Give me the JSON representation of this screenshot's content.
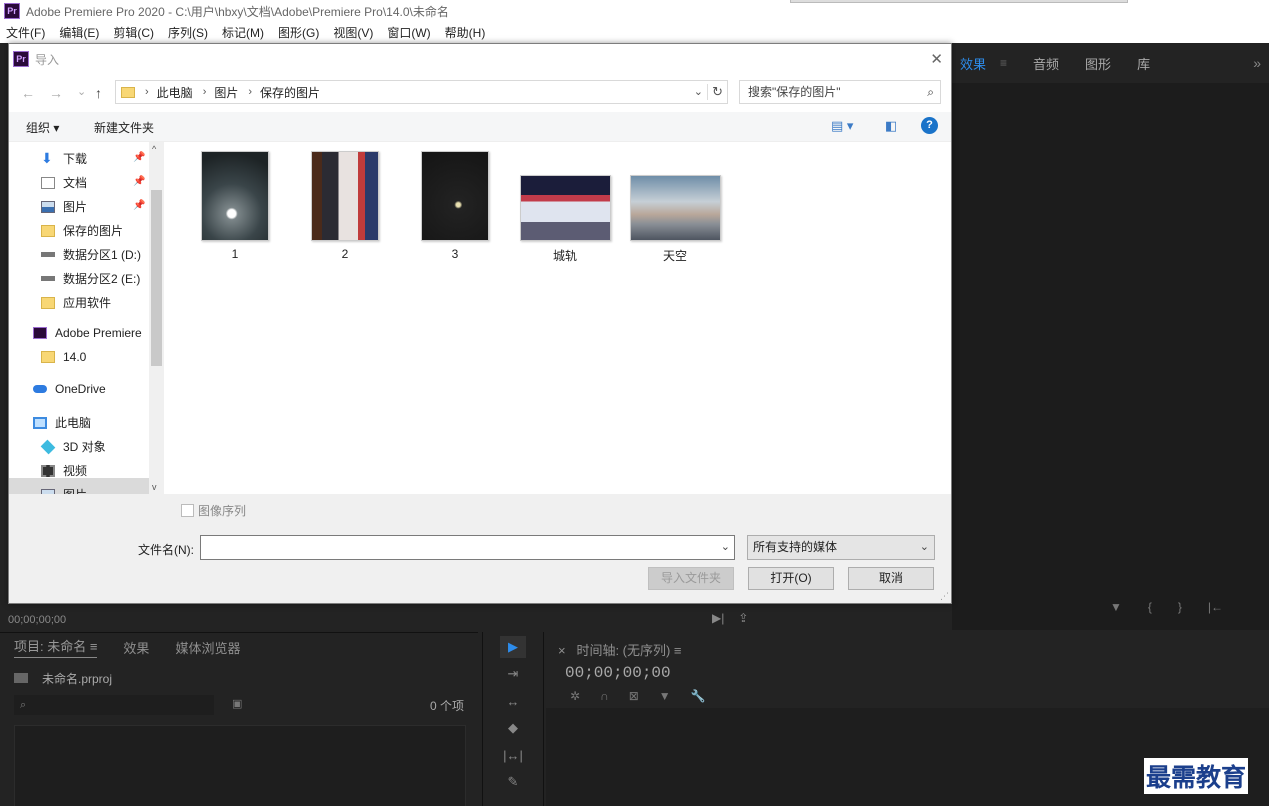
{
  "app": {
    "logo": "Pr",
    "title": "Adobe Premiere Pro 2020 - C:\\用户\\hbxy\\文档\\Adobe\\Premiere Pro\\14.0\\未命名",
    "menu": [
      "文件(F)",
      "编辑(E)",
      "剪辑(C)",
      "序列(S)",
      "标记(M)",
      "图形(G)",
      "视图(V)",
      "窗口(W)",
      "帮助(H)"
    ]
  },
  "right_tabs": {
    "active": "效果",
    "sep": "≡",
    "tabs": [
      "音频",
      "图形",
      "库"
    ],
    "more": "»"
  },
  "right_controls": [
    "▼",
    "{",
    "}",
    "|←"
  ],
  "source": {
    "timecode": "00;00;00;00",
    "icons": [
      "▶|",
      "⇪"
    ]
  },
  "project": {
    "tabs": [
      "项目: 未命名 ≡",
      "效果",
      "媒体浏览器"
    ],
    "file": "未命名.prproj",
    "search_icon": "⌕",
    "cam_icon": "▣",
    "count": "0 个项"
  },
  "tools": [
    "▶",
    "⇥",
    "↔",
    "◆",
    "|↔|",
    "✎"
  ],
  "timeline": {
    "tab": "时间轴: (无序列) ≡",
    "close": "×",
    "time": "00;00;00;00",
    "icons": [
      "✲",
      "∩",
      "⊠",
      "▼",
      "🔧"
    ]
  },
  "watermark": "最需教育",
  "dialog": {
    "title": "导入",
    "close": "✕",
    "nav": {
      "back": "←",
      "forward": "→",
      "recent": "⌄",
      "up": "↑"
    },
    "breadcrumbs": [
      "此电脑",
      "图片",
      "保存的图片"
    ],
    "crumb_sep": "›",
    "addr_drop": "⌄",
    "refresh": "↻",
    "search_placeholder": "搜索\"保存的图片\"",
    "search_icon": "⌕",
    "organize": "组织 ▾",
    "new_folder": "新建文件夹",
    "view_icon": "▤ ▾",
    "pane_icon": "◧",
    "help_icon": "?",
    "nav_pane": [
      {
        "label": "下载",
        "icon": "down",
        "pin": true
      },
      {
        "label": "文档",
        "icon": "doc",
        "pin": true
      },
      {
        "label": "图片",
        "icon": "pic",
        "pin": true
      },
      {
        "label": "保存的图片",
        "icon": "folder"
      },
      {
        "label": "数据分区1 (D:)",
        "icon": "drive"
      },
      {
        "label": "数据分区2 (E:)",
        "icon": "drive"
      },
      {
        "label": "应用软件",
        "icon": "folder"
      },
      {
        "label": "Adobe Premiere",
        "icon": "pr"
      },
      {
        "label": "14.0",
        "icon": "folder"
      },
      {
        "label": "OneDrive",
        "icon": "cloud"
      },
      {
        "label": "此电脑",
        "icon": "pc"
      },
      {
        "label": "3D 对象",
        "icon": "cube"
      },
      {
        "label": "视频",
        "icon": "film"
      },
      {
        "label": "图片",
        "icon": "pic"
      }
    ],
    "pin_glyph": "📌",
    "scroll_up": "^",
    "scroll_down": "v",
    "files": [
      "1",
      "2",
      "3",
      "城轨",
      "天空"
    ],
    "image_sequence": "图像序列",
    "filename_label": "文件名(N):",
    "filename_value": "",
    "filename_drop": "⌄",
    "file_type": "所有支持的媒体",
    "file_type_drop": "⌄",
    "import_folder": "导入文件夹",
    "open": "打开(O)",
    "cancel": "取消",
    "grip": "⋰"
  }
}
